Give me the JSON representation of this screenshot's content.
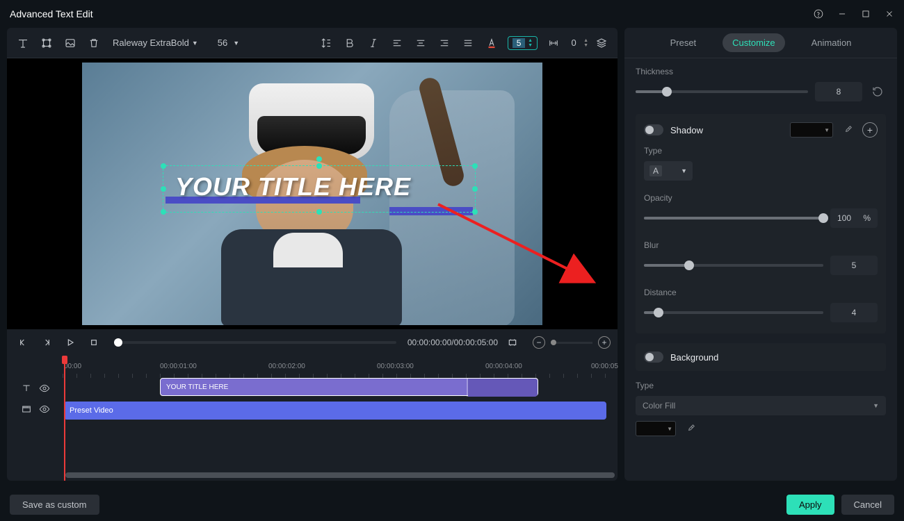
{
  "window": {
    "title": "Advanced Text Edit"
  },
  "toolbar": {
    "font": "Raleway ExtraBold",
    "font_size": "56",
    "size_input": "5",
    "spacing": "0"
  },
  "preview": {
    "title_text": "YOUR TITLE HERE"
  },
  "playback": {
    "current_time": "00:00:00:00",
    "total_time": "00:00:05:00"
  },
  "timeline": {
    "ticks": [
      "00:00",
      "00:00:01:00",
      "00:00:02:00",
      "00:00:03:00",
      "00:00:04:00",
      "00:00:05"
    ],
    "text_clip_label": "YOUR TITLE HERE",
    "video_clip_label": "Preset Video"
  },
  "tabs": {
    "preset": "Preset",
    "customize": "Customize",
    "animation": "Animation"
  },
  "panel": {
    "thickness": {
      "label": "Thickness",
      "value": "8"
    },
    "shadow": {
      "label": "Shadow"
    },
    "type": {
      "label": "Type",
      "value": "A"
    },
    "opacity": {
      "label": "Opacity",
      "value": "100",
      "unit": "%"
    },
    "blur": {
      "label": "Blur",
      "value": "5"
    },
    "distance": {
      "label": "Distance",
      "value": "4"
    },
    "background": {
      "label": "Background"
    },
    "bg_type": {
      "label": "Type",
      "value": "Color Fill"
    }
  },
  "footer": {
    "save": "Save as custom",
    "apply": "Apply",
    "cancel": "Cancel"
  }
}
